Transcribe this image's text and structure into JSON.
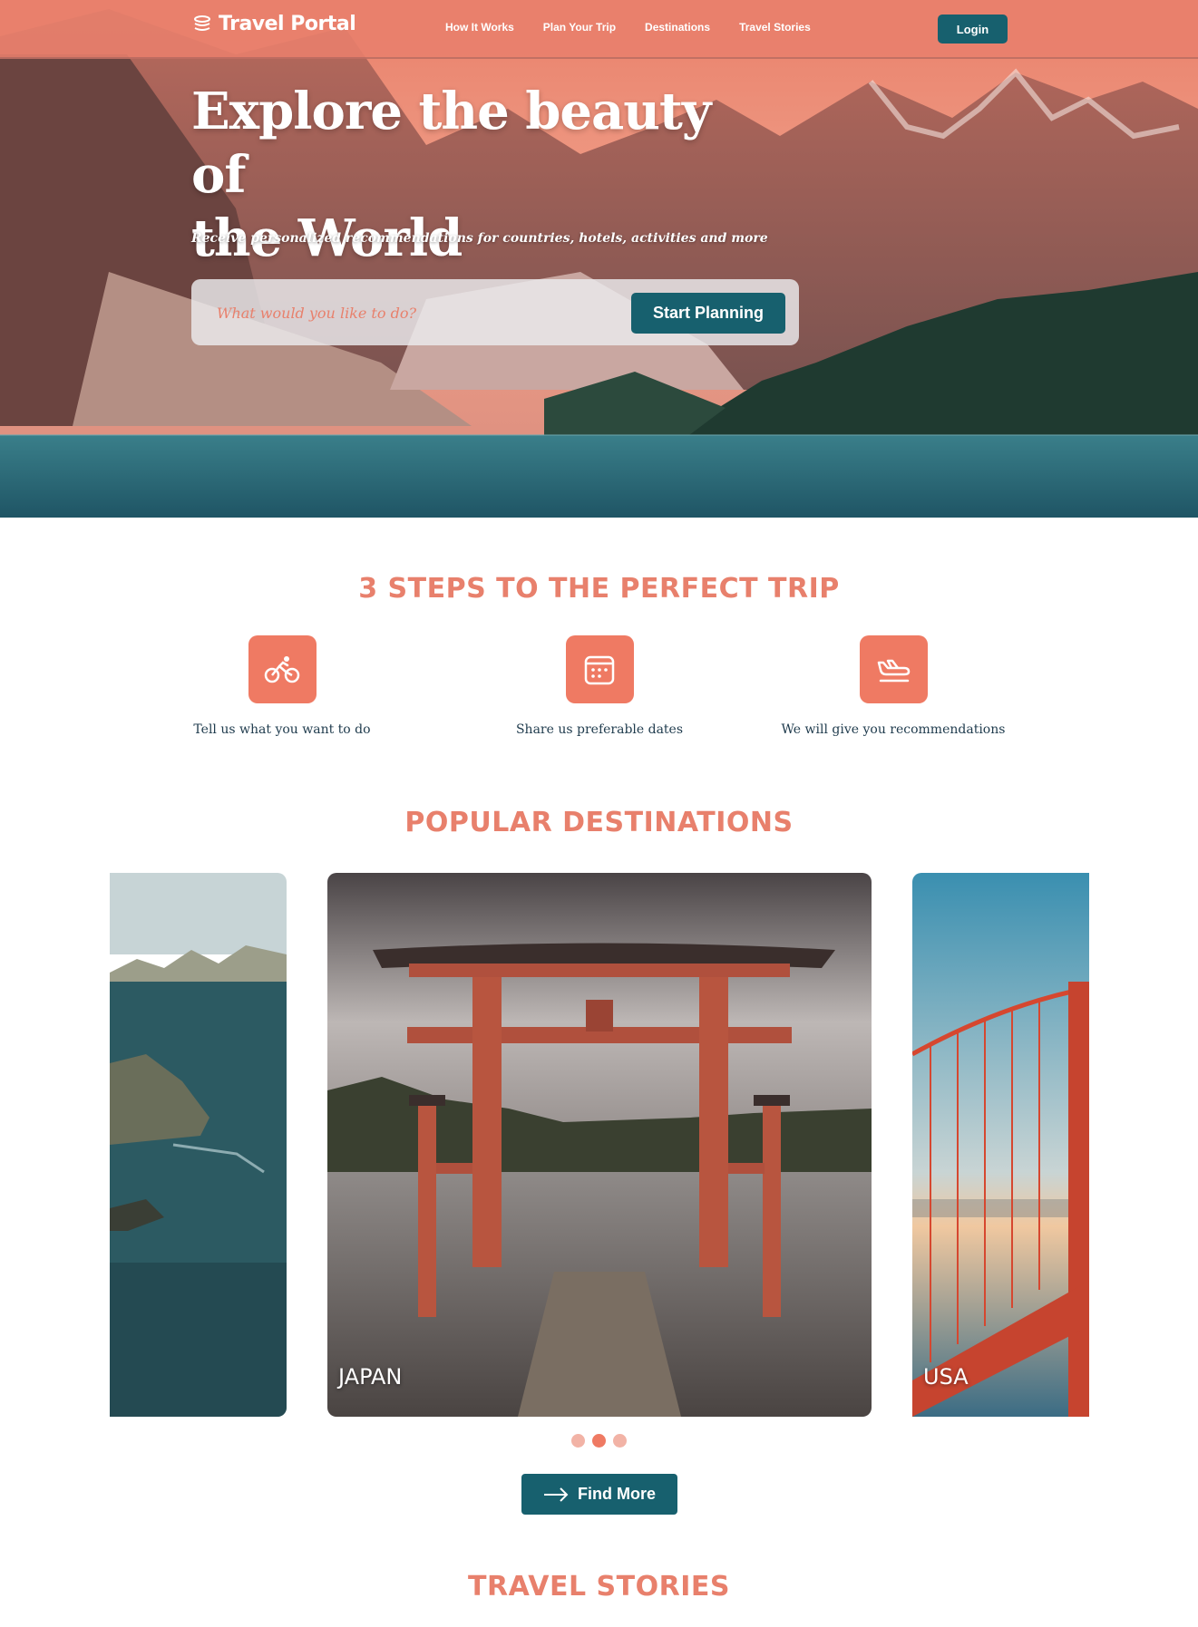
{
  "brand": {
    "name": "Travel Portal",
    "logo_icon": "stack-logo-icon"
  },
  "nav": {
    "links": [
      "How It Works",
      "Plan Your Trip",
      "Destinations",
      "Travel Stories"
    ],
    "login_label": "Login"
  },
  "hero": {
    "title_line1": "Explore the beauty of",
    "title_line2": "the World",
    "subtitle": "Receive personalized recommendations for countries, hotels, activities and more",
    "search_placeholder": "What would you like to do?",
    "cta_label": "Start Planning"
  },
  "steps": {
    "title": "3 STEPS TO THE PERFECT TRIP",
    "items": [
      {
        "label": "Tell us what you want to do",
        "icon": "bicycle-icon"
      },
      {
        "label": "Share us preferable dates",
        "icon": "calendar-icon"
      },
      {
        "label": "We will give you recommendations",
        "icon": "airplane-icon"
      }
    ]
  },
  "destinations": {
    "title": "POPULAR DESTINATIONS",
    "cards": [
      {
        "label": ""
      },
      {
        "label": "JAPAN"
      },
      {
        "label": "USA"
      }
    ],
    "active_dot": 2,
    "dot_count": 3,
    "button_label": "Find More"
  },
  "stories": {
    "title": "TRAVEL STORIES"
  },
  "colors": {
    "accent": "#ef7a63",
    "title_accent": "#e8806c",
    "primary_button": "#17606e",
    "text": "#1f3b4d"
  }
}
